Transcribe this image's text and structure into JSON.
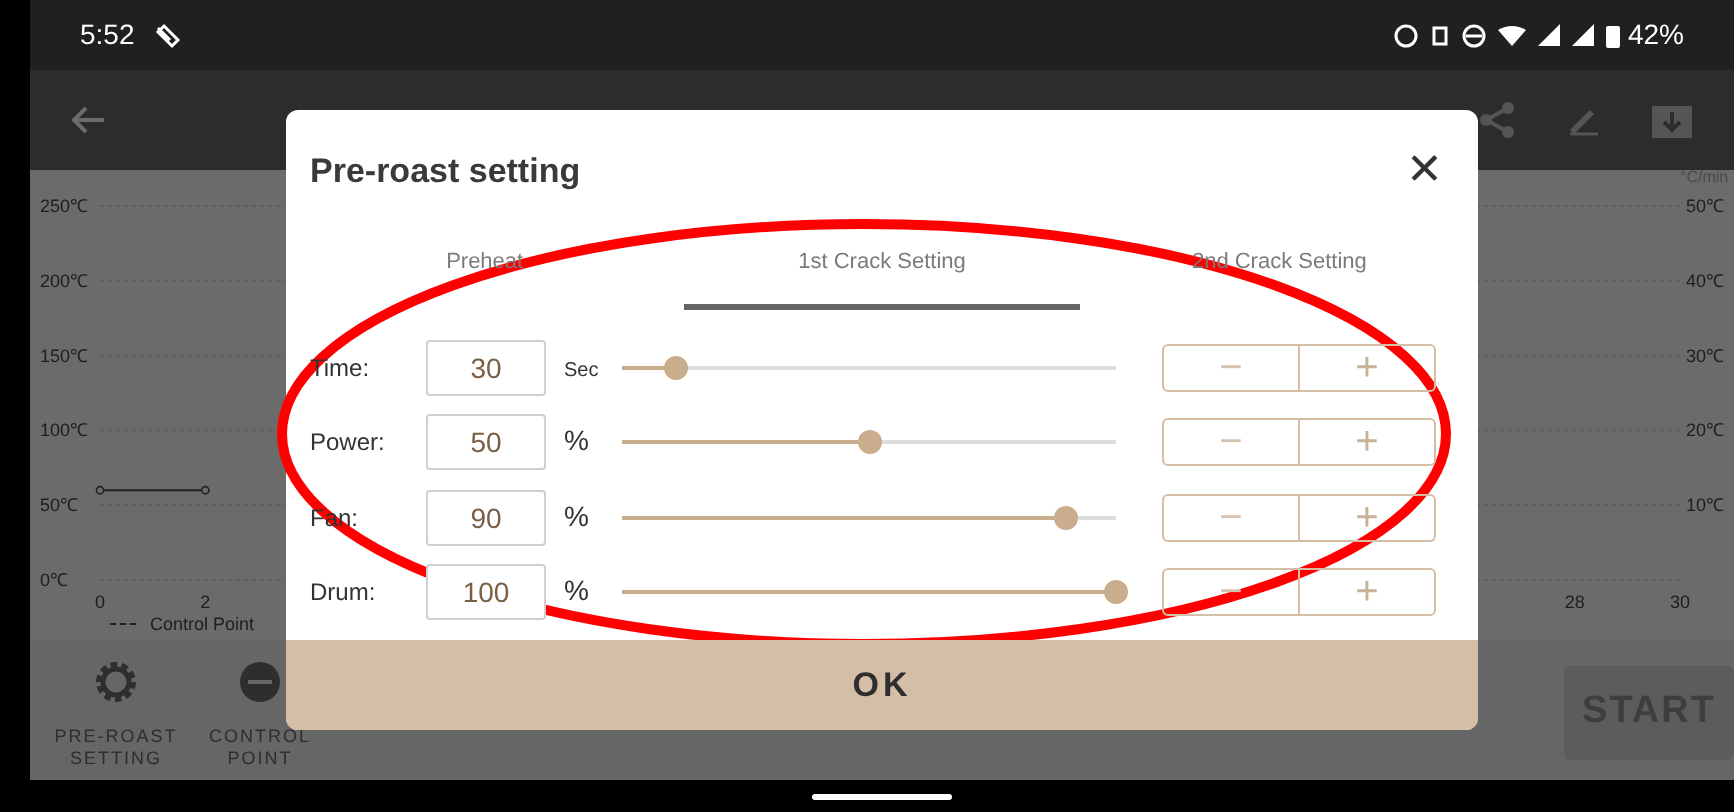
{
  "status_bar": {
    "time": "5:52",
    "battery": "42%"
  },
  "chart": {
    "right_axis_unit": "°C/min",
    "right_axis_labels": [
      "50℃",
      "40℃",
      "30℃",
      "20℃",
      "10℃"
    ],
    "chart_data": {
      "type": "line",
      "grid": true,
      "x": [
        0,
        2
      ],
      "series": [
        {
          "name": "Control Point",
          "color": "#222222",
          "marker": true,
          "values": [
            60,
            60
          ]
        }
      ],
      "xlim": [
        0,
        30
      ],
      "ylim": [
        0,
        250
      ],
      "xticks": [
        0,
        2,
        28,
        30
      ],
      "yticks": [
        {
          "value": 0,
          "label": "0℃"
        },
        {
          "value": 50,
          "label": "50℃"
        },
        {
          "value": 100,
          "label": "100℃"
        },
        {
          "value": 150,
          "label": "150℃"
        },
        {
          "value": 200,
          "label": "200℃"
        },
        {
          "value": 250,
          "label": "250℃"
        }
      ]
    }
  },
  "bottom_bar": {
    "items": [
      {
        "kind": "gear",
        "label": "PRE-ROAST SETTING"
      },
      {
        "kind": "control",
        "label": "CONTROL POINT"
      }
    ],
    "start_button": "START"
  },
  "dialog": {
    "title": "Pre-roast setting",
    "close": "✕",
    "tabs": [
      {
        "label": "Preheat",
        "selected": false
      },
      {
        "label": "1st Crack Setting",
        "selected": true
      },
      {
        "label": "2nd Crack Setting",
        "selected": false
      }
    ],
    "rows": [
      {
        "label": "Time:",
        "value": "30",
        "unit": "Sec",
        "level": 0.11,
        "minus": "−",
        "plus": "+"
      },
      {
        "label": "Power:",
        "value": "50",
        "unit": "%",
        "level": 0.5,
        "minus": "−",
        "plus": "+"
      },
      {
        "label": "Fan:",
        "value": "90",
        "unit": "%",
        "level": 0.9,
        "minus": "−",
        "plus": "+"
      },
      {
        "label": "Drum:",
        "value": "100",
        "unit": "%",
        "level": 1.0,
        "minus": "−",
        "plus": "+"
      }
    ],
    "ok": "OK"
  }
}
